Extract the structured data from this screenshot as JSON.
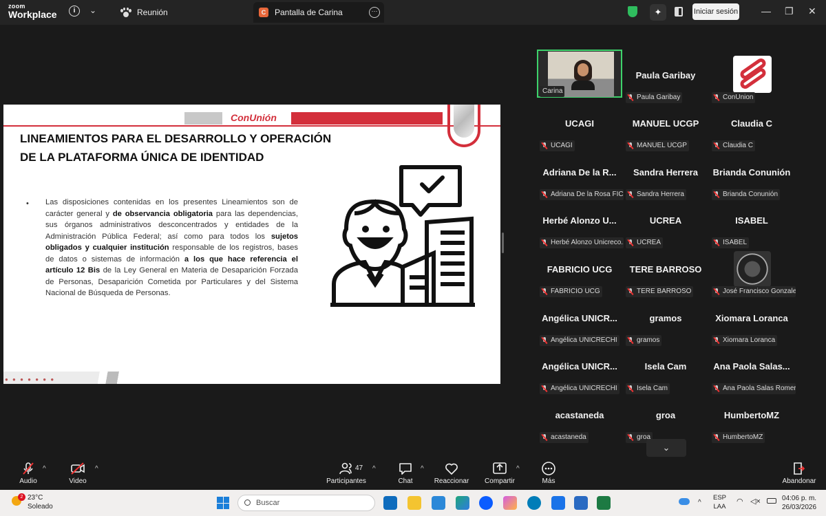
{
  "app": {
    "logo_line1": "zoom",
    "logo_line2": "Workplace"
  },
  "titlebar": {
    "meeting_tab": "Reunión",
    "share_tab": "Pantalla de Carina",
    "share_badge": "C",
    "sign_in": "Iniciar sesión"
  },
  "slide": {
    "brand": "ConUnión",
    "title_line1": "LINEAMIENTOS PARA EL DESARROLLO Y OPERACIÓN",
    "title_line2": "DE LA PLATAFORMA ÚNICA DE IDENTIDAD",
    "bullet": "•",
    "body_1": "Las disposiciones contenidas en los presentes Lineamientos son de carácter general y ",
    "body_b1": "de observancia obligatoria",
    "body_2": " para las dependencias, sus órganos administrativos desconcentrados y entidades de la Administración Pública Federal; así como para todos los ",
    "body_b2": "sujetos obligados y cualquier institución",
    "body_3": " responsable de los registros, bases de datos o sistemas de información ",
    "body_b3": "a los que hace referencia el artículo 12 Bis",
    "body_4": " de la Ley General en Materia de Desaparición Forzada de Personas, Desaparición Cometida por Particulares y del Sistema Nacional de Búsqueda de Personas."
  },
  "participants": [
    {
      "name": "",
      "label": "Carina"
    },
    {
      "name": "Paula Garibay",
      "label": "Paula Garibay"
    },
    {
      "name": "",
      "label": "ConUnion"
    },
    {
      "name": "UCAGI",
      "label": "UCAGI"
    },
    {
      "name": "MANUEL UCGP",
      "label": "MANUEL UCGP"
    },
    {
      "name": "Claudia C",
      "label": "Claudia C"
    },
    {
      "name": "Adriana De la R...",
      "label": "Adriana De la Rosa FIC..."
    },
    {
      "name": "Sandra Herrera",
      "label": "Sandra Herrera"
    },
    {
      "name": "Brianda Conunión",
      "label": "Brianda Conunión"
    },
    {
      "name": "Herbé Alonzo U...",
      "label": "Herbé Alonzo Unicreco..."
    },
    {
      "name": "UCREA",
      "label": "UCREA"
    },
    {
      "name": "ISABEL",
      "label": "ISABEL"
    },
    {
      "name": "FABRICIO UCG",
      "label": "FABRICIO UCG"
    },
    {
      "name": "TERE BARROSO",
      "label": "TERE BARROSO"
    },
    {
      "name": "",
      "label": "José Francisco Gonzalez"
    },
    {
      "name": "Angélica UNICR...",
      "label": "Angélica UNICRECHI"
    },
    {
      "name": "gramos",
      "label": "gramos"
    },
    {
      "name": "Xiomara Loranca",
      "label": "Xiomara Loranca"
    },
    {
      "name": "Angélica UNICR...",
      "label": "Angélica UNICRECHI"
    },
    {
      "name": "Isela Cam",
      "label": "Isela Cam"
    },
    {
      "name": "Ana Paola Salas...",
      "label": "Ana Paola Salas Romero"
    },
    {
      "name": "acastaneda",
      "label": "acastaneda"
    },
    {
      "name": "groa",
      "label": "groa"
    },
    {
      "name": "HumbertoMZ",
      "label": "HumbertoMZ"
    }
  ],
  "toolbar": {
    "audio": "Audio",
    "video": "Video",
    "participants": "Participantes",
    "participants_count": "47",
    "chat": "Chat",
    "react": "Reaccionar",
    "share": "Compartir",
    "more": "Más",
    "leave": "Abandonar"
  },
  "taskbar": {
    "weather_badge": "2",
    "temp": "23°C",
    "condition": "Soleado",
    "search": "Buscar",
    "lang1": "ESP",
    "lang2": "LAA",
    "time": "04:06 p. m.",
    "date": "26/03/2026"
  },
  "colors": {
    "brand_red": "#d32f3b",
    "active_green": "#3dd36b"
  }
}
